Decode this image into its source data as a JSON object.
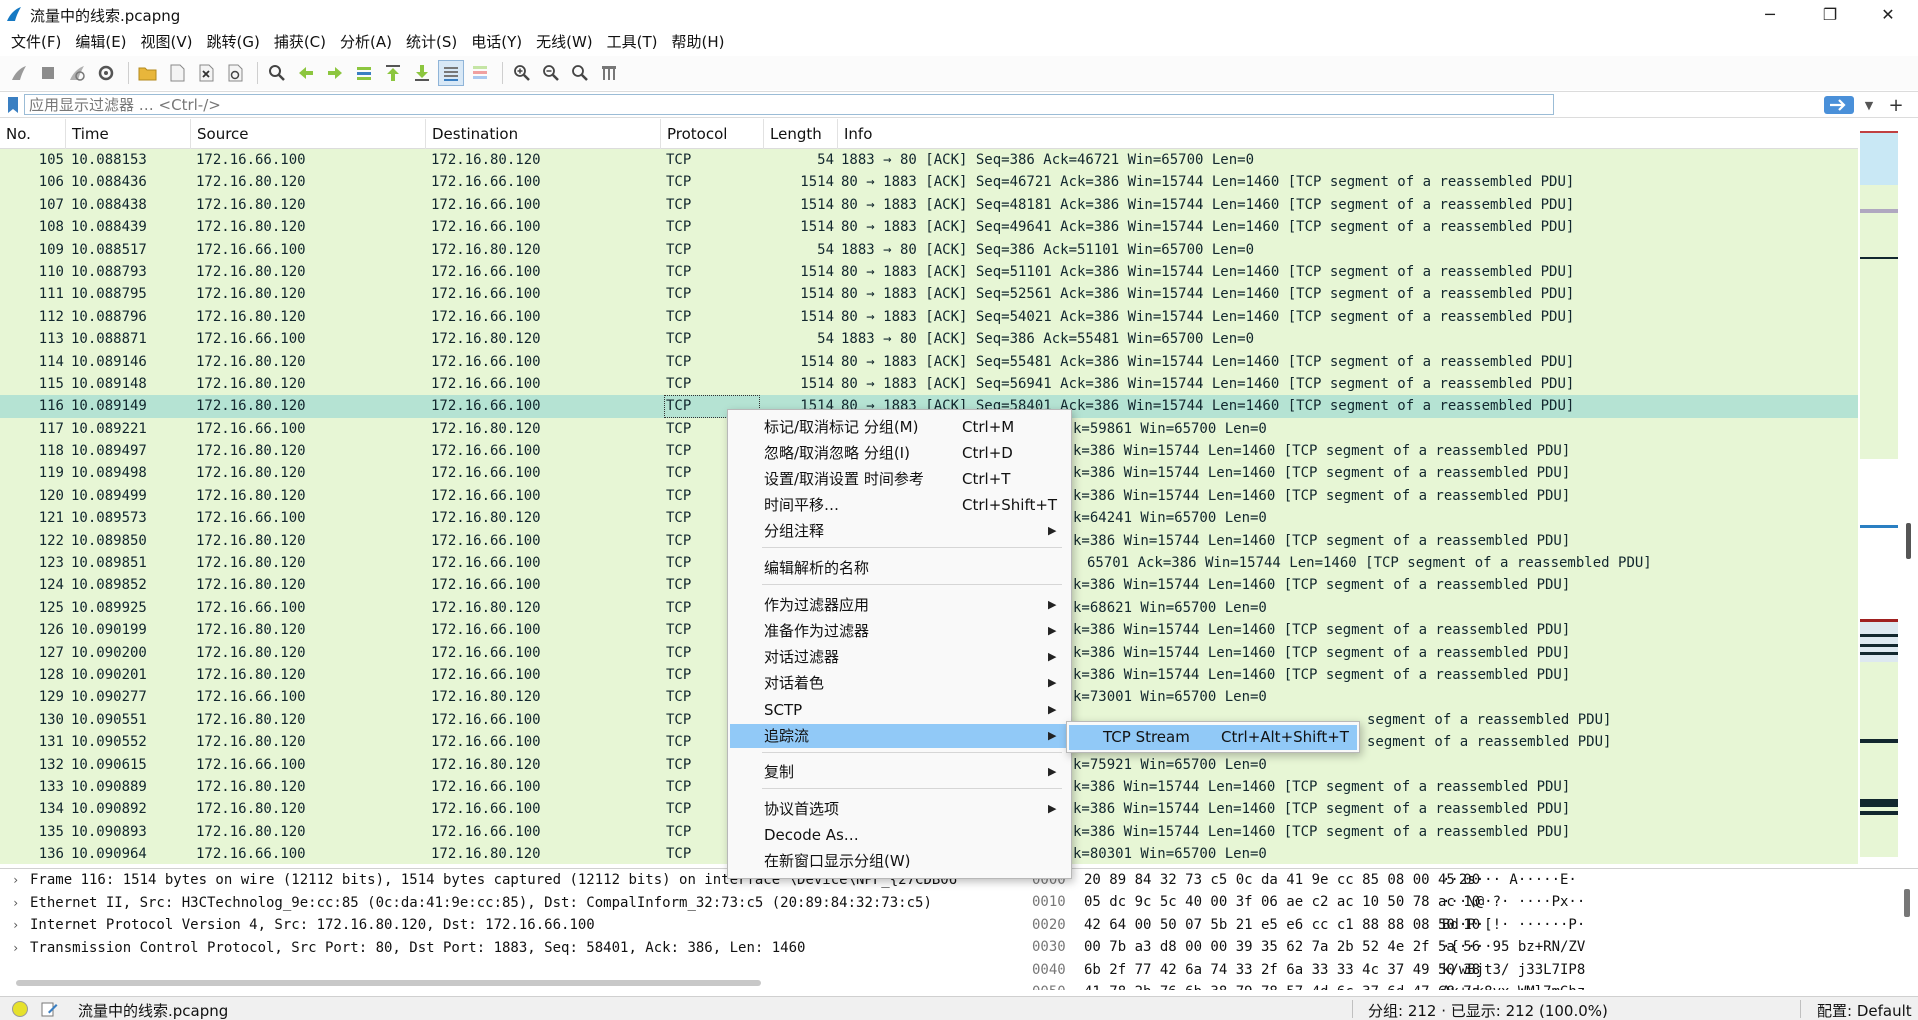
{
  "window": {
    "title": "流量中的线索.pcapng",
    "minimize": "─",
    "maximize": "❐",
    "close": "✕"
  },
  "menu": [
    "文件(F)",
    "编辑(E)",
    "视图(V)",
    "跳转(G)",
    "捕获(C)",
    "分析(A)",
    "统计(S)",
    "电话(Y)",
    "无线(W)",
    "工具(T)",
    "帮助(H)"
  ],
  "filter": {
    "placeholder": "应用显示过滤器 … <Ctrl-/>",
    "value": ""
  },
  "columns": [
    "No.",
    "Time",
    "Source",
    "Destination",
    "Protocol",
    "Length",
    "Info"
  ],
  "packets": [
    {
      "no": "105",
      "time": "10.088153",
      "src": "172.16.66.100",
      "dst": "172.16.80.120",
      "proto": "TCP",
      "len": "54",
      "info": "1883 → 80 [ACK] Seq=386 Ack=46721 Win=65700 Len=0"
    },
    {
      "no": "106",
      "time": "10.088436",
      "src": "172.16.80.120",
      "dst": "172.16.66.100",
      "proto": "TCP",
      "len": "1514",
      "info": "80 → 1883 [ACK] Seq=46721 Ack=386 Win=15744 Len=1460 [TCP segment of a reassembled PDU]"
    },
    {
      "no": "107",
      "time": "10.088438",
      "src": "172.16.80.120",
      "dst": "172.16.66.100",
      "proto": "TCP",
      "len": "1514",
      "info": "80 → 1883 [ACK] Seq=48181 Ack=386 Win=15744 Len=1460 [TCP segment of a reassembled PDU]"
    },
    {
      "no": "108",
      "time": "10.088439",
      "src": "172.16.80.120",
      "dst": "172.16.66.100",
      "proto": "TCP",
      "len": "1514",
      "info": "80 → 1883 [ACK] Seq=49641 Ack=386 Win=15744 Len=1460 [TCP segment of a reassembled PDU]"
    },
    {
      "no": "109",
      "time": "10.088517",
      "src": "172.16.66.100",
      "dst": "172.16.80.120",
      "proto": "TCP",
      "len": "54",
      "info": "1883 → 80 [ACK] Seq=386 Ack=51101 Win=65700 Len=0"
    },
    {
      "no": "110",
      "time": "10.088793",
      "src": "172.16.80.120",
      "dst": "172.16.66.100",
      "proto": "TCP",
      "len": "1514",
      "info": "80 → 1883 [ACK] Seq=51101 Ack=386 Win=15744 Len=1460 [TCP segment of a reassembled PDU]"
    },
    {
      "no": "111",
      "time": "10.088795",
      "src": "172.16.80.120",
      "dst": "172.16.66.100",
      "proto": "TCP",
      "len": "1514",
      "info": "80 → 1883 [ACK] Seq=52561 Ack=386 Win=15744 Len=1460 [TCP segment of a reassembled PDU]"
    },
    {
      "no": "112",
      "time": "10.088796",
      "src": "172.16.80.120",
      "dst": "172.16.66.100",
      "proto": "TCP",
      "len": "1514",
      "info": "80 → 1883 [ACK] Seq=54021 Ack=386 Win=15744 Len=1460 [TCP segment of a reassembled PDU]"
    },
    {
      "no": "113",
      "time": "10.088871",
      "src": "172.16.66.100",
      "dst": "172.16.80.120",
      "proto": "TCP",
      "len": "54",
      "info": "1883 → 80 [ACK] Seq=386 Ack=55481 Win=65700 Len=0"
    },
    {
      "no": "114",
      "time": "10.089146",
      "src": "172.16.80.120",
      "dst": "172.16.66.100",
      "proto": "TCP",
      "len": "1514",
      "info": "80 → 1883 [ACK] Seq=55481 Ack=386 Win=15744 Len=1460 [TCP segment of a reassembled PDU]"
    },
    {
      "no": "115",
      "time": "10.089148",
      "src": "172.16.80.120",
      "dst": "172.16.66.100",
      "proto": "TCP",
      "len": "1514",
      "info": "80 → 1883 [ACK] Seq=56941 Ack=386 Win=15744 Len=1460 [TCP segment of a reassembled PDU]"
    },
    {
      "no": "116",
      "time": "10.089149",
      "src": "172.16.80.120",
      "dst": "172.16.66.100",
      "proto": "TCP",
      "len": "1514",
      "info": "80 → 1883 [ACK] Seq=58401 Ack=386 Win=15744 Len=1460 [TCP segment of a reassembled PDU]",
      "selected": true
    },
    {
      "no": "117",
      "time": "10.089221",
      "src": "172.16.66.100",
      "dst": "172.16.80.120",
      "proto": "TCP",
      "len": "",
      "info": "k=59861 Win=65700 Len=0",
      "info_offset": true
    },
    {
      "no": "118",
      "time": "10.089497",
      "src": "172.16.80.120",
      "dst": "172.16.66.100",
      "proto": "TCP",
      "len": "",
      "info": "k=386 Win=15744 Len=1460 [TCP segment of a reassembled PDU]",
      "info_offset": true
    },
    {
      "no": "119",
      "time": "10.089498",
      "src": "172.16.80.120",
      "dst": "172.16.66.100",
      "proto": "TCP",
      "len": "",
      "info": "k=386 Win=15744 Len=1460 [TCP segment of a reassembled PDU]",
      "info_offset": true
    },
    {
      "no": "120",
      "time": "10.089499",
      "src": "172.16.80.120",
      "dst": "172.16.66.100",
      "proto": "TCP",
      "len": "",
      "info": "k=386 Win=15744 Len=1460 [TCP segment of a reassembled PDU]",
      "info_offset": true
    },
    {
      "no": "121",
      "time": "10.089573",
      "src": "172.16.66.100",
      "dst": "172.16.80.120",
      "proto": "TCP",
      "len": "",
      "info": "k=64241 Win=65700 Len=0",
      "info_offset": true
    },
    {
      "no": "122",
      "time": "10.089850",
      "src": "172.16.80.120",
      "dst": "172.16.66.100",
      "proto": "TCP",
      "len": "",
      "info": "k=386 Win=15744 Len=1460 [TCP segment of a reassembled PDU]",
      "info_offset": true
    },
    {
      "no": "123",
      "time": "10.089851",
      "src": "172.16.80.120",
      "dst": "172.16.66.100",
      "proto": "TCP",
      "len": "",
      "info": "65701 Ack=386 Win=15744 Len=1460 [TCP segment of a reassembled PDU]",
      "info_offset": true
    },
    {
      "no": "124",
      "time": "10.089852",
      "src": "172.16.80.120",
      "dst": "172.16.66.100",
      "proto": "TCP",
      "len": "",
      "info": "k=386 Win=15744 Len=1460 [TCP segment of a reassembled PDU]",
      "info_offset": true
    },
    {
      "no": "125",
      "time": "10.089925",
      "src": "172.16.66.100",
      "dst": "172.16.80.120",
      "proto": "TCP",
      "len": "",
      "info": "k=68621 Win=65700 Len=0",
      "info_offset": true
    },
    {
      "no": "126",
      "time": "10.090199",
      "src": "172.16.80.120",
      "dst": "172.16.66.100",
      "proto": "TCP",
      "len": "",
      "info": "k=386 Win=15744 Len=1460 [TCP segment of a reassembled PDU]",
      "info_offset": true
    },
    {
      "no": "127",
      "time": "10.090200",
      "src": "172.16.80.120",
      "dst": "172.16.66.100",
      "proto": "TCP",
      "len": "",
      "info": "k=386 Win=15744 Len=1460 [TCP segment of a reassembled PDU]",
      "info_offset": true
    },
    {
      "no": "128",
      "time": "10.090201",
      "src": "172.16.80.120",
      "dst": "172.16.66.100",
      "proto": "TCP",
      "len": "",
      "info": "k=386 Win=15744 Len=1460 [TCP segment of a reassembled PDU]",
      "info_offset": true
    },
    {
      "no": "129",
      "time": "10.090277",
      "src": "172.16.66.100",
      "dst": "172.16.80.120",
      "proto": "TCP",
      "len": "",
      "info": "k=73001 Win=65700 Len=0",
      "info_offset": true
    },
    {
      "no": "130",
      "time": "10.090551",
      "src": "172.16.80.120",
      "dst": "172.16.66.100",
      "proto": "TCP",
      "len": "",
      "info": "",
      "info_offset": true
    },
    {
      "no": "131",
      "time": "10.090552",
      "src": "172.16.80.120",
      "dst": "172.16.66.100",
      "proto": "TCP",
      "len": "",
      "info": "",
      "info_offset": true
    },
    {
      "no": "132",
      "time": "10.090615",
      "src": "172.16.66.100",
      "dst": "172.16.80.120",
      "proto": "TCP",
      "len": "",
      "info": "k=75921 Win=65700 Len=0",
      "info_offset": true
    },
    {
      "no": "133",
      "time": "10.090889",
      "src": "172.16.80.120",
      "dst": "172.16.66.100",
      "proto": "TCP",
      "len": "",
      "info": "k=386 Win=15744 Len=1460 [TCP segment of a reassembled PDU]",
      "info_offset": true
    },
    {
      "no": "134",
      "time": "10.090892",
      "src": "172.16.80.120",
      "dst": "172.16.66.100",
      "proto": "TCP",
      "len": "",
      "info": "k=386 Win=15744 Len=1460 [TCP segment of a reassembled PDU]",
      "info_offset": true
    },
    {
      "no": "135",
      "time": "10.090893",
      "src": "172.16.80.120",
      "dst": "172.16.66.100",
      "proto": "TCP",
      "len": "",
      "info": "k=386 Win=15744 Len=1460 [TCP segment of a reassembled PDU]",
      "info_offset": true
    },
    {
      "no": "136",
      "time": "10.090964",
      "src": "172.16.66.100",
      "dst": "172.16.80.120",
      "proto": "TCP",
      "len": "",
      "info": "k=80301 Win=65700 Len=0",
      "info_offset": true
    }
  ],
  "row130_partial": "segment of a reassembled PDU]",
  "row131_partial": "segment of a reassembled PDU]",
  "details": [
    "Frame 116: 1514 bytes on wire (12112 bits), 1514 bytes captured (12112 bits) on interface \\Device\\NPF_{27CDB06",
    "Ethernet II, Src: H3CTechnolog_9e:cc:85 (0c:da:41:9e:cc:85), Dst: CompalInform_32:73:c5 (20:89:84:32:73:c5)",
    "Internet Protocol Version 4, Src: 172.16.80.120, Dst: 172.16.66.100",
    "Transmission Control Protocol, Src Port: 80, Dst Port: 1883, Seq: 58401, Ack: 386, Len: 1460"
  ],
  "bytes": [
    {
      "off": "0000",
      "hex": "20 89 84 32 73 c5 0c da  41 9e cc 85 08 00 45 00",
      "ascii": "··2s··· A·····E·"
    },
    {
      "off": "0010",
      "hex": "05 dc 9c 5c 40 00 3f 06  ae c2 ac 10 50 78 ac 10",
      "ascii": "···\\@·?· ····Px··"
    },
    {
      "off": "0020",
      "hex": "42 64 00 50 07 5b 21 e5  e6 cc c1 88 88 08 50 10",
      "ascii": "Bd·P·[!· ······P·"
    },
    {
      "off": "0030",
      "hex": "00 7b a3 d8 00 00 39 35  62 7a 2b 52 4e 2f 5a 56",
      "ascii": "·{····95 bz+RN/ZV"
    },
    {
      "off": "0040",
      "hex": "6b 2f 77 42 6a 74 33 2f  6a 33 33 4c 37 49 50 38",
      "ascii": "k/wBjt3/ j33L7IP8"
    },
    {
      "off": "0050",
      "hex": "41 78 2b 76 6b 38 79 78  57 4d 6c 37 6d 47 68 7a",
      "ascii": "Ax+vk8yx WMl7mGhz"
    }
  ],
  "context_menu": {
    "items": [
      {
        "label": "标记/取消标记 分组(M)",
        "shortcut": "Ctrl+M"
      },
      {
        "label": "忽略/取消忽略 分组(I)",
        "shortcut": "Ctrl+D"
      },
      {
        "label": "设置/取消设置 时间参考",
        "shortcut": "Ctrl+T"
      },
      {
        "label": "时间平移…",
        "shortcut": "Ctrl+Shift+T"
      },
      {
        "label": "分组注释",
        "shortcut": "",
        "submenu": true
      },
      {
        "label": "编辑解析的名称",
        "shortcut": ""
      },
      {
        "label": "作为过滤器应用",
        "shortcut": "",
        "submenu": true
      },
      {
        "label": "准备作为过滤器",
        "shortcut": "",
        "submenu": true
      },
      {
        "label": "对话过滤器",
        "shortcut": "",
        "submenu": true
      },
      {
        "label": "对话着色",
        "shortcut": "",
        "submenu": true
      },
      {
        "label": "SCTP",
        "shortcut": "",
        "submenu": true
      },
      {
        "label": "追踪流",
        "shortcut": "",
        "submenu": true,
        "highlight": true
      },
      {
        "label": "复制",
        "shortcut": "",
        "submenu": true
      },
      {
        "label": "协议首选项",
        "shortcut": "",
        "submenu": true
      },
      {
        "label": "Decode As…",
        "shortcut": ""
      },
      {
        "label": "在新窗口显示分组(W)",
        "shortcut": ""
      }
    ],
    "submenu_arrow": "▶"
  },
  "submenu": {
    "label": "TCP Stream",
    "shortcut": "Ctrl+Alt+Shift+T"
  },
  "status": {
    "filename": "流量中的线索.pcapng",
    "counts": "分组: 212 · 已显示: 212 (100.0%)",
    "profile": "配置: Default"
  },
  "colors": {
    "row_bg": "#e7f6d5",
    "selected_bg": "#b5e3d3",
    "menu_highlight": "#91c9f7"
  }
}
